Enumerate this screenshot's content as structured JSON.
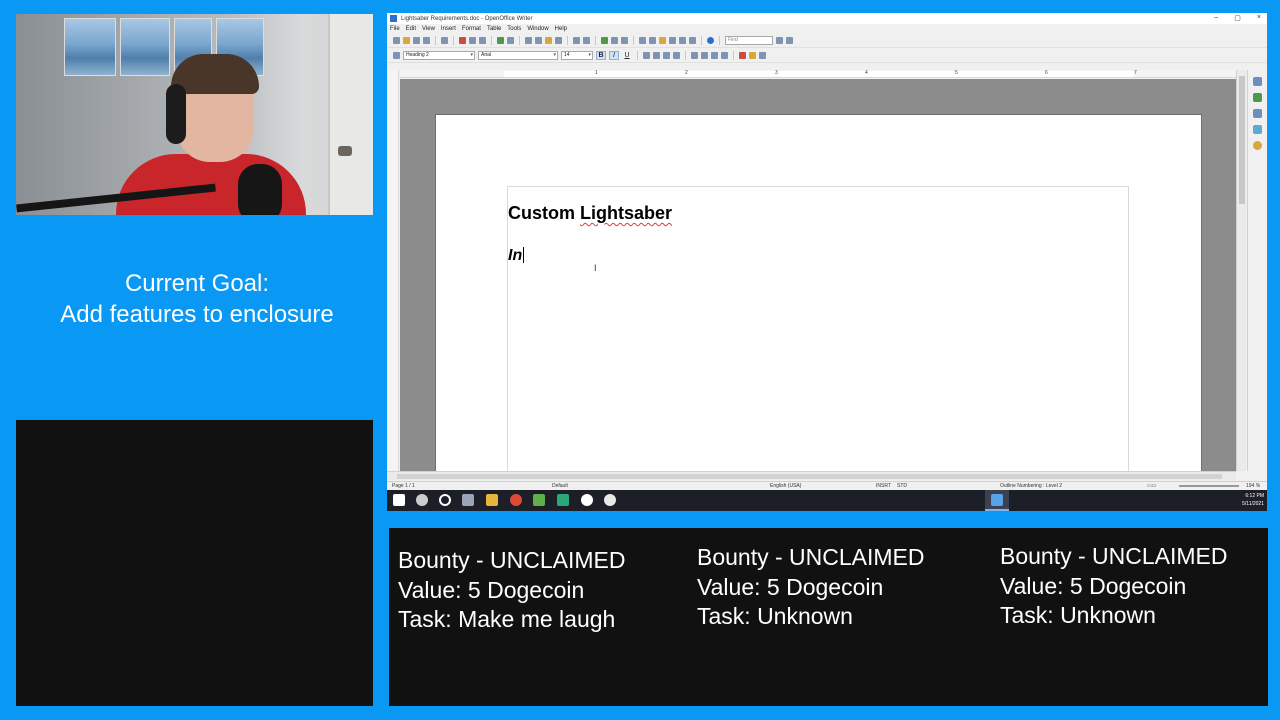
{
  "overlay": {
    "goal_line1": "Current Goal:",
    "goal_line2": "Add features to enclosure"
  },
  "bounties": [
    {
      "status": "Bounty - UNCLAIMED",
      "value": "Value: 5 Dogecoin",
      "task": "Task: Make me laugh"
    },
    {
      "status": "Bounty - UNCLAIMED",
      "value": "Value: 5 Dogecoin",
      "task": "Task: Unknown"
    },
    {
      "status": "Bounty - UNCLAIMED",
      "value": "Value: 5 Dogecoin",
      "task": "Task: Unknown"
    }
  ],
  "window": {
    "title": "Lightsaber Requirements.doc - OpenOffice Writer",
    "controls": {
      "minimize": "–",
      "maximize": "▢",
      "close": "×"
    }
  },
  "menu": [
    "File",
    "Edit",
    "View",
    "Insert",
    "Format",
    "Table",
    "Tools",
    "Window",
    "Help"
  ],
  "toolbar": {
    "find_placeholder": "Find",
    "style": "Heading 2",
    "font": "Arial",
    "size": "14",
    "bold": "B",
    "italic": "I",
    "underline": "U"
  },
  "ruler_marks": [
    "1",
    "2",
    "3",
    "4",
    "5",
    "6",
    "7"
  ],
  "document": {
    "heading_word1": "Custom",
    "heading_word2": "Lightsaber",
    "body_text": "In"
  },
  "status": {
    "page": "Page 1 / 1",
    "page_style": "Default",
    "language": "English (USA)",
    "insert_mode": "INSRT",
    "selection_mode": "STD",
    "outline": "Outline Numbering : Level 2",
    "zoom": "194 %"
  },
  "taskbar": {
    "time": "6:12 PM",
    "date": "5/11/2021"
  },
  "colors": {
    "background": "#0a98f5",
    "panel": "#111111",
    "spell_underline": "#e03b3b"
  }
}
